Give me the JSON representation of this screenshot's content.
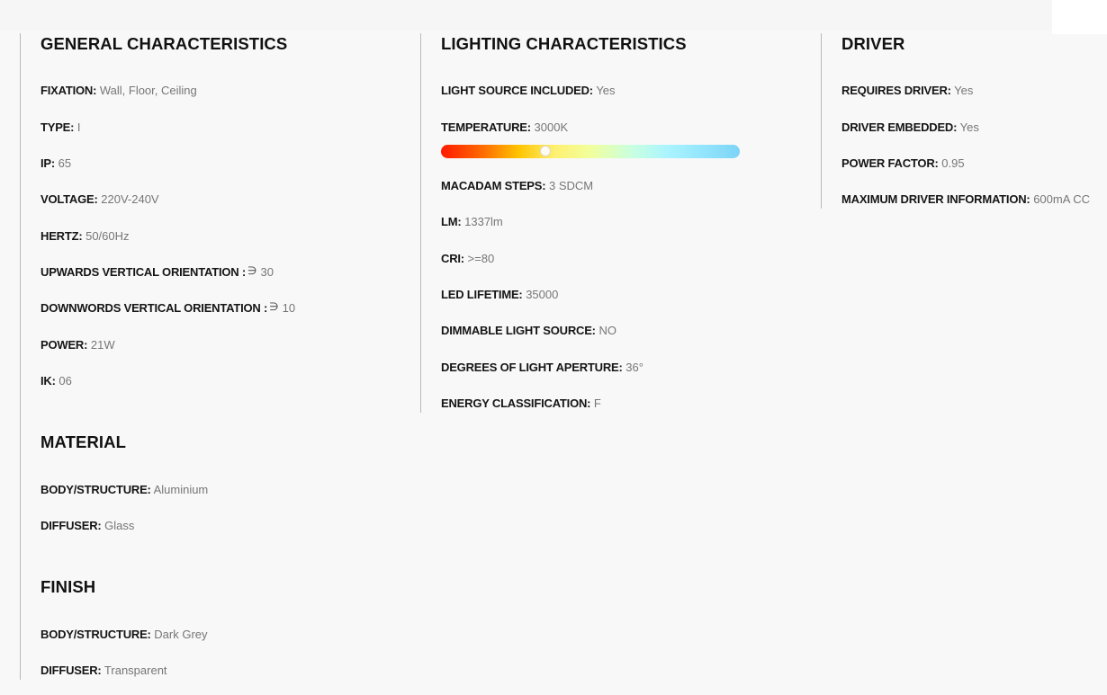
{
  "general": {
    "title": "GENERAL CHARACTERISTICS",
    "items": [
      {
        "label": "FIXATION:",
        "value": "Wall, Floor, Ceiling"
      },
      {
        "label": "TYPE:",
        "value": "I"
      },
      {
        "label": "IP:",
        "value": "65"
      },
      {
        "label": "VOLTAGE:",
        "value": "220V-240V"
      },
      {
        "label": "HERTZ:",
        "value": "50/60Hz"
      },
      {
        "label": "UPWARDS VERTICAL ORIENTATION :",
        "value": "30",
        "icon": "orientation-icon"
      },
      {
        "label": "DOWNWORDS VERTICAL ORIENTATION :",
        "value": "10",
        "icon": "orientation-icon"
      },
      {
        "label": "POWER:",
        "value": "21W"
      },
      {
        "label": "IK:",
        "value": "06"
      }
    ]
  },
  "material": {
    "title": "MATERIAL",
    "items": [
      {
        "label": "BODY/STRUCTURE:",
        "value": "Aluminium"
      },
      {
        "label": "DIFFUSER:",
        "value": "Glass"
      }
    ]
  },
  "finish": {
    "title": "FINISH",
    "items": [
      {
        "label": "BODY/STRUCTURE:",
        "value": "Dark Grey"
      },
      {
        "label": "DIFFUSER:",
        "value": "Transparent"
      }
    ]
  },
  "lighting": {
    "title": "LIGHTING CHARACTERISTICS",
    "items": [
      {
        "label": "LIGHT SOURCE INCLUDED:",
        "value": "Yes"
      },
      {
        "label": "TEMPERATURE:",
        "value": "3000K"
      },
      {
        "label": "MACADAM STEPS:",
        "value": "3 SDCM"
      },
      {
        "label": "LM:",
        "value": "1337lm"
      },
      {
        "label": "CRI:",
        "value": ">=80"
      },
      {
        "label": "LED LIFETIME:",
        "value": "35000"
      },
      {
        "label": "DIMMABLE LIGHT SOURCE:",
        "value": "NO"
      },
      {
        "label": "DEGREES OF LIGHT APERTURE:",
        "value": "36°"
      },
      {
        "label": "ENERGY CLASSIFICATION:",
        "value": "F"
      }
    ],
    "temperature_scale": {
      "position_fraction": 0.35,
      "gradient_colors": [
        "#ff1a00",
        "#ffc400",
        "#fff070",
        "#aaf4ff",
        "#7dd3f7"
      ]
    }
  },
  "driver": {
    "title": "DRIVER",
    "items": [
      {
        "label": "REQUIRES DRIVER:",
        "value": "Yes"
      },
      {
        "label": "DRIVER EMBEDDED:",
        "value": "Yes"
      },
      {
        "label": "POWER FACTOR:",
        "value": "0.95"
      },
      {
        "label": "MAXIMUM DRIVER INFORMATION:",
        "value": "600mA CC"
      }
    ]
  },
  "colors": {
    "background": "#f8f8f9",
    "label": "#151515",
    "value": "#767676",
    "divider": "#b9b9b9"
  }
}
